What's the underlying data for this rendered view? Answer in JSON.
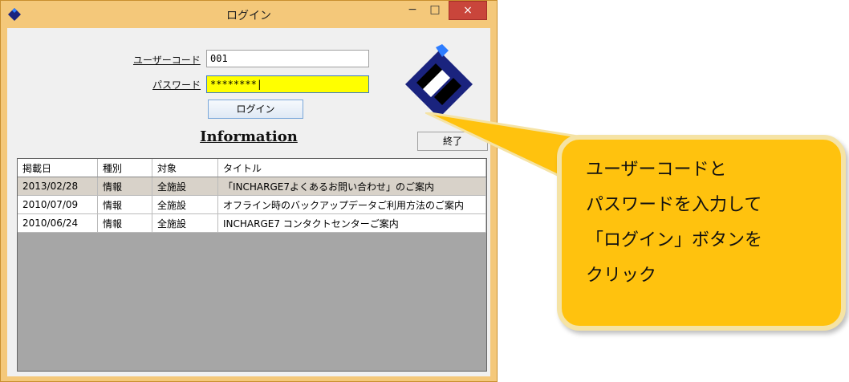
{
  "window": {
    "title": "ログイン",
    "controls": {
      "minimize": "−",
      "maximize": "□",
      "close": "×"
    }
  },
  "login_form": {
    "user_code_label": "ユーザーコード",
    "user_code_value": "001",
    "password_label": "パスワード",
    "password_value": "********|",
    "login_button": "ログイン"
  },
  "information": {
    "heading": "Information",
    "close_button": "終了",
    "columns": [
      "掲載日",
      "種別",
      "対象",
      "タイトル"
    ],
    "rows": [
      [
        "2013/02/28",
        "情報",
        "全施設",
        "「INCHARGE7よくあるお問い合わせ」のご案内"
      ],
      [
        "2010/07/09",
        "情報",
        "全施設",
        "オフライン時のバックアップデータご利用方法のご案内"
      ],
      [
        "2010/06/24",
        "情報",
        "全施設",
        "INCHARGE7 コンタクトセンターご案内"
      ]
    ]
  },
  "callout": {
    "lines": [
      "ユーザーコードと",
      "パスワードを入力して",
      "「ログイン」ボタンを",
      "クリック"
    ]
  },
  "colors": {
    "accent": "#ffc20e",
    "logo_blue": "#1a237e",
    "password_bg": "#ffff00",
    "close_red": "#c9453b"
  },
  "icons": [
    "app-logo-icon",
    "company-logo-icon"
  ]
}
